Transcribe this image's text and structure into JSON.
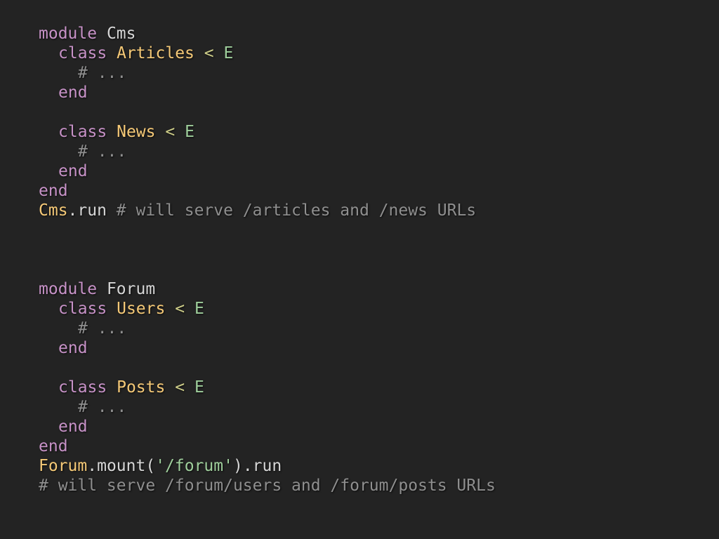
{
  "colors": {
    "background": "#232323",
    "keyword": "#c792c7",
    "class_name": "#f5c977",
    "superclass": "#9fcf9c",
    "operator": "#cfcf8a",
    "string": "#9fcf9c",
    "comment": "#8f8f8f",
    "text": "#d6d6d6"
  },
  "code": {
    "cms": {
      "module_kw": "module",
      "module_name": "Cms",
      "class_kw": "class",
      "inherit_op": "<",
      "superclass": "E",
      "ellipsis_comment": "# ...",
      "end_kw": "end",
      "class_a": "Articles",
      "class_b": "News",
      "call_receiver": "Cms",
      "call_method": ".run",
      "call_comment": "# will serve /articles and /news URLs"
    },
    "forum": {
      "module_kw": "module",
      "module_name": "Forum",
      "class_kw": "class",
      "inherit_op": "<",
      "superclass": "E",
      "ellipsis_comment": "# ...",
      "end_kw": "end",
      "class_a": "Users",
      "class_b": "Posts",
      "call_receiver": "Forum",
      "call_mount": ".mount(",
      "call_arg": "'/forum'",
      "call_close": ").run",
      "call_comment": "# will serve /forum/users and /forum/posts URLs"
    }
  }
}
